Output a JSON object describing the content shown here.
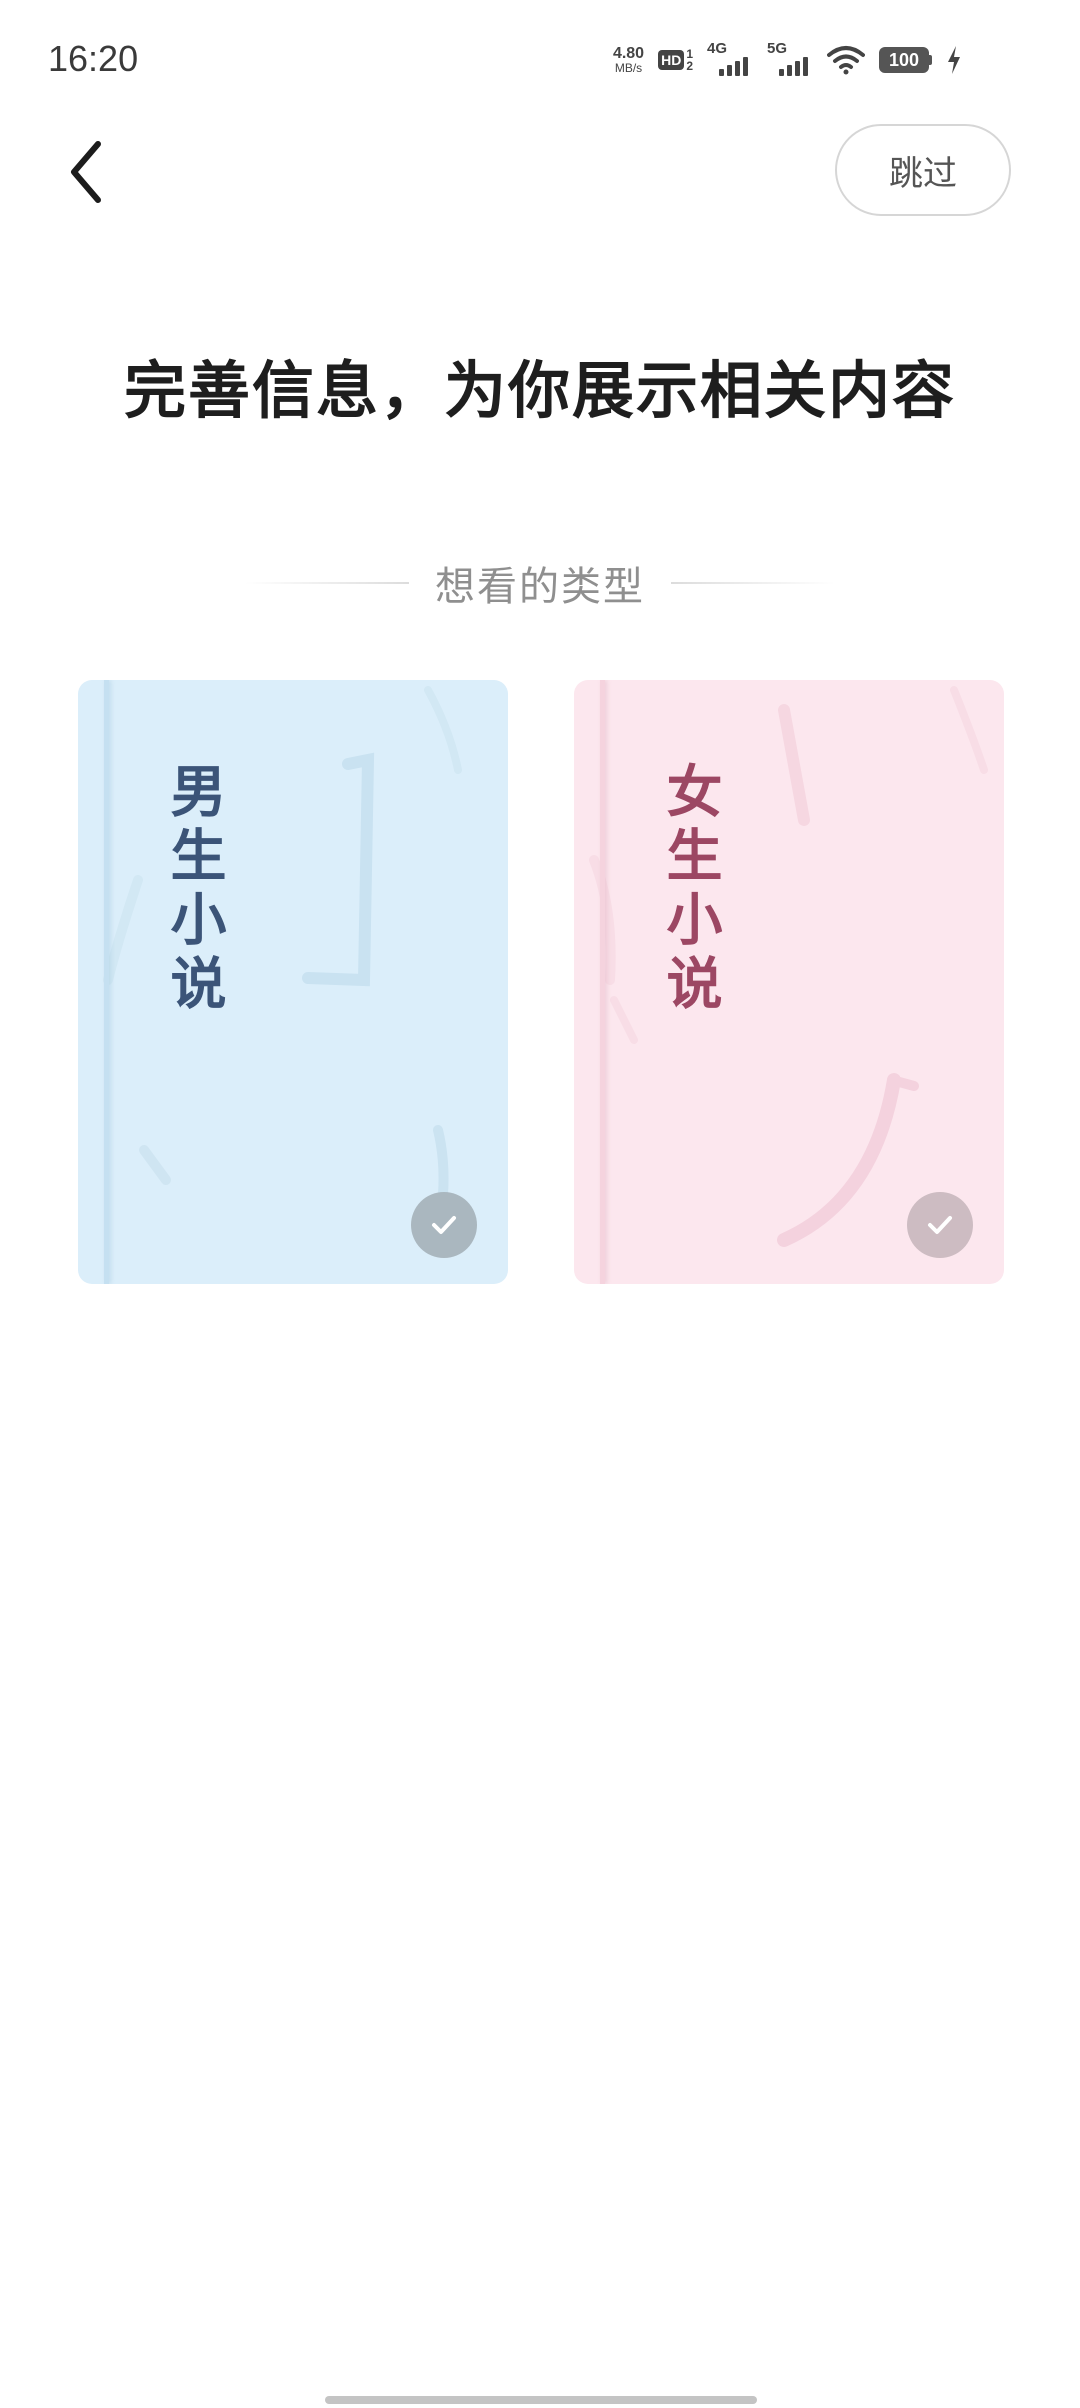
{
  "status_bar": {
    "time": "16:20",
    "net_speed_value": "4.80",
    "net_speed_unit": "MB/s",
    "hd_label": "HD",
    "hd_sim_top": "1",
    "hd_sim_bottom": "2",
    "signal_1_label": "4G",
    "signal_2_label": "5G",
    "battery_level": "100",
    "icons": [
      "wifi-icon",
      "charging-icon"
    ]
  },
  "nav": {
    "back_icon": "chevron-left-icon",
    "skip_label": "跳过"
  },
  "main": {
    "title": "完善信息，为你展示相关内容",
    "section_title": "想看的类型",
    "cards": [
      {
        "title": "男生小说",
        "accent": "#dbeefa",
        "text_color": "#3b5478",
        "selected_icon": "check-icon"
      },
      {
        "title": "女生小说",
        "accent": "#fce7ee",
        "text_color": "#9c4763",
        "selected_icon": "check-icon"
      }
    ]
  }
}
